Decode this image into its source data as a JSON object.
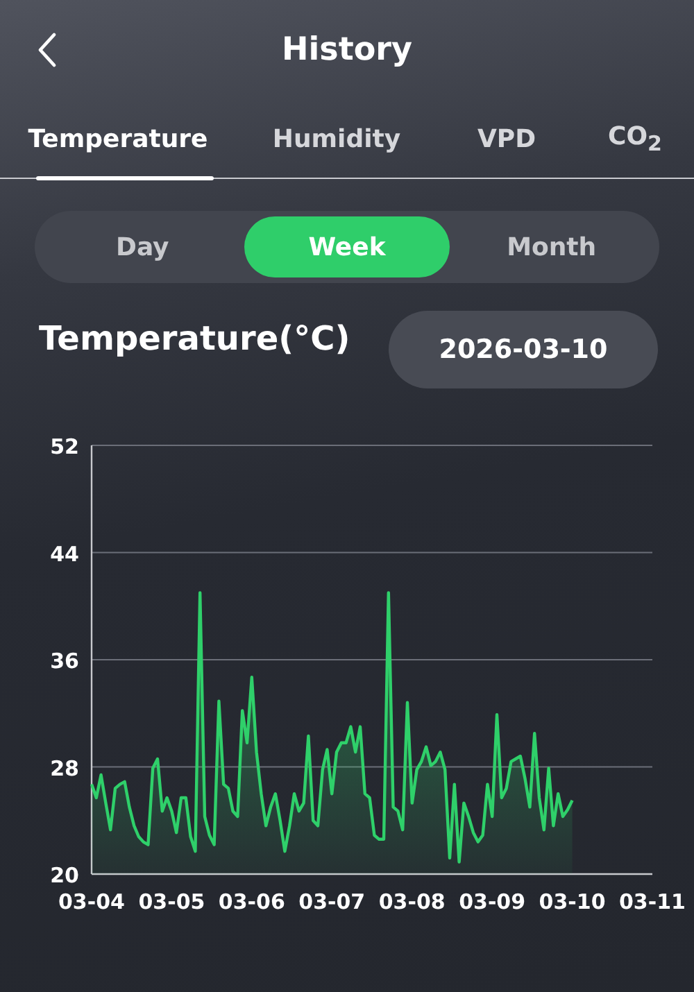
{
  "header": {
    "title": "History"
  },
  "tabs": [
    {
      "label": "Temperature",
      "selected": true
    },
    {
      "label": "Humidity",
      "selected": false
    },
    {
      "label": "VPD",
      "selected": false
    },
    {
      "label": "CO$_{2}$",
      "selected": false
    }
  ],
  "range": [
    {
      "label": "Day",
      "selected": false
    },
    {
      "label": "Week",
      "selected": true
    },
    {
      "label": "Month",
      "selected": false
    }
  ],
  "chart_title": "Temperature(°C)",
  "date": "2026-03-10",
  "chart_data": {
    "type": "area",
    "grid": true,
    "ylim": [
      20,
      52
    ],
    "yticks": [
      20,
      28,
      36,
      44,
      52
    ],
    "categories": [
      "03-04",
      null,
      null,
      null,
      null,
      null,
      null,
      null,
      null,
      null,
      null,
      null,
      null,
      null,
      null,
      null,
      null,
      "03-05",
      null,
      null,
      null,
      null,
      null,
      null,
      null,
      null,
      null,
      null,
      null,
      null,
      null,
      null,
      null,
      null,
      "03-06",
      null,
      null,
      null,
      null,
      null,
      null,
      null,
      null,
      null,
      null,
      null,
      null,
      null,
      null,
      null,
      null,
      "03-07",
      null,
      null,
      null,
      null,
      null,
      null,
      null,
      null,
      null,
      null,
      null,
      null,
      null,
      null,
      null,
      null,
      "03-08",
      null,
      null,
      null,
      null,
      null,
      null,
      null,
      null,
      null,
      null,
      null,
      null,
      null,
      null,
      null,
      null,
      "03-09",
      null,
      null,
      null,
      null,
      null,
      null,
      null,
      null,
      null,
      null,
      null,
      null,
      null,
      null,
      null,
      null,
      "03-10",
      null,
      null,
      null,
      null,
      null,
      null,
      null,
      null,
      null,
      null,
      null,
      null,
      null,
      null,
      null,
      null,
      "03-11"
    ],
    "series": [
      {
        "color": "#2fd06a",
        "values": [
          26.7,
          25.7,
          27.4,
          25.3,
          23.3,
          26.4,
          26.7,
          26.9,
          25,
          23.6,
          22.8,
          22.4,
          22.2,
          27.9,
          28.6,
          24.7,
          25.7,
          24.7,
          23.1,
          25.7,
          25.7,
          22.8,
          21.7,
          41,
          24.3,
          22.9,
          22.2,
          32.9,
          26.7,
          26.4,
          24.7,
          24.3,
          32.2,
          29.8,
          34.7,
          29.1,
          26,
          23.6,
          25,
          26,
          24,
          21.7,
          23.6,
          26,
          24.7,
          25.3,
          30.3,
          24,
          23.6,
          27.8,
          29.3,
          26,
          29.1,
          29.8,
          29.8,
          31,
          29.1,
          31,
          26,
          25.7,
          22.9,
          22.6,
          22.6,
          41,
          25,
          24.7,
          23.3,
          32.8,
          25.3,
          27.8,
          28.4,
          29.5,
          28.1,
          28.4,
          29.1,
          27.8,
          21.2,
          26.7,
          20.9,
          25.3,
          24.3,
          23.1,
          22.4,
          22.9,
          26.7,
          24.3,
          31.9,
          25.7,
          26.4,
          28.4,
          28.6,
          28.8,
          27.1,
          25,
          30.5,
          25.7,
          23.3,
          27.9,
          23.6,
          26,
          24.3,
          24.8,
          25.5,
          null,
          null,
          null,
          null,
          null,
          null,
          null,
          null,
          null,
          null,
          null,
          null,
          null,
          null,
          null,
          null,
          null
        ]
      }
    ]
  }
}
